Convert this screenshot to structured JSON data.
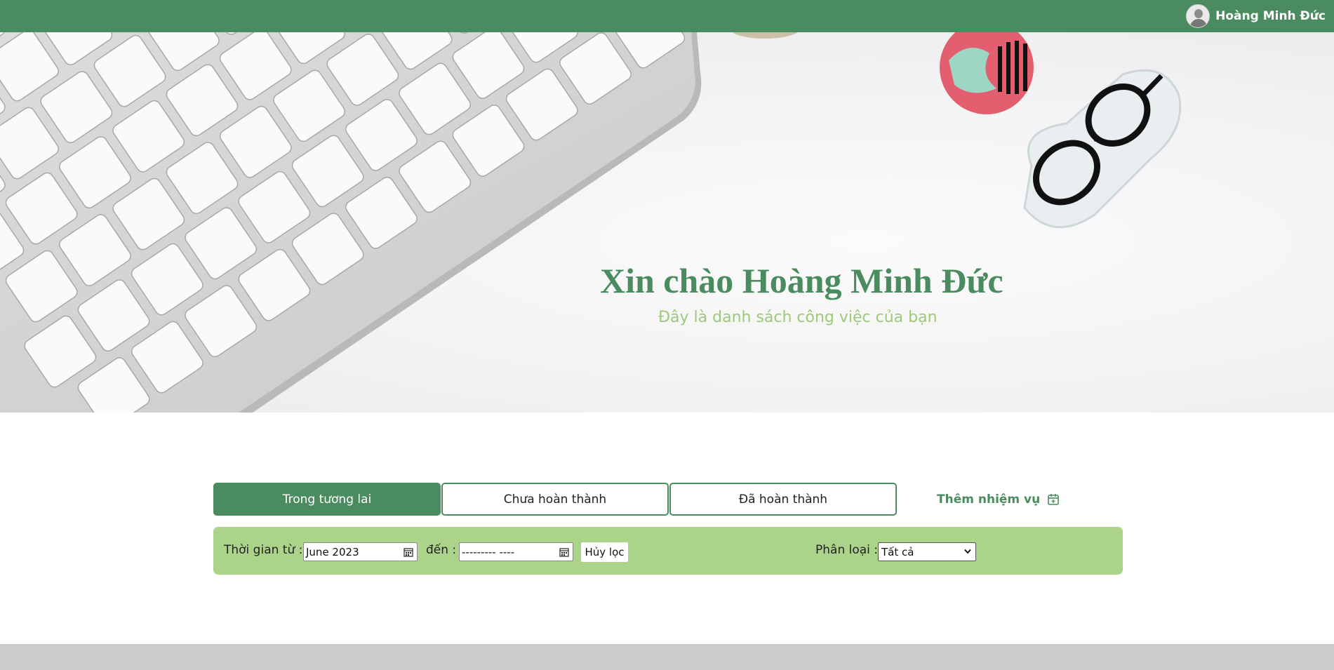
{
  "header": {
    "user_name": "Hoàng Minh Đức"
  },
  "hero": {
    "title": "Xin chào Hoàng Minh Đức",
    "subtitle": "Đây là danh sách công việc của bạn"
  },
  "tabs": [
    {
      "label": "Trong tương lai",
      "active": true
    },
    {
      "label": "Chưa hoàn thành",
      "active": false
    },
    {
      "label": "Đã hoàn thành",
      "active": false
    }
  ],
  "add_task": {
    "label": "Thêm nhiệm vụ",
    "icon": "calendar-add-icon"
  },
  "filter": {
    "from_label": "Thời gian từ :",
    "from_value": "June 2023",
    "to_label": "đến :",
    "to_value": "--------- ----",
    "clear_label": "Hủy lọc",
    "category_label": "Phân loại :",
    "category_value": "Tất cả"
  },
  "colors": {
    "primary": "#4a8c5f",
    "filter_bg": "#acd38a",
    "subtitle": "#9cc97c",
    "footer": "#cbcbcb"
  }
}
